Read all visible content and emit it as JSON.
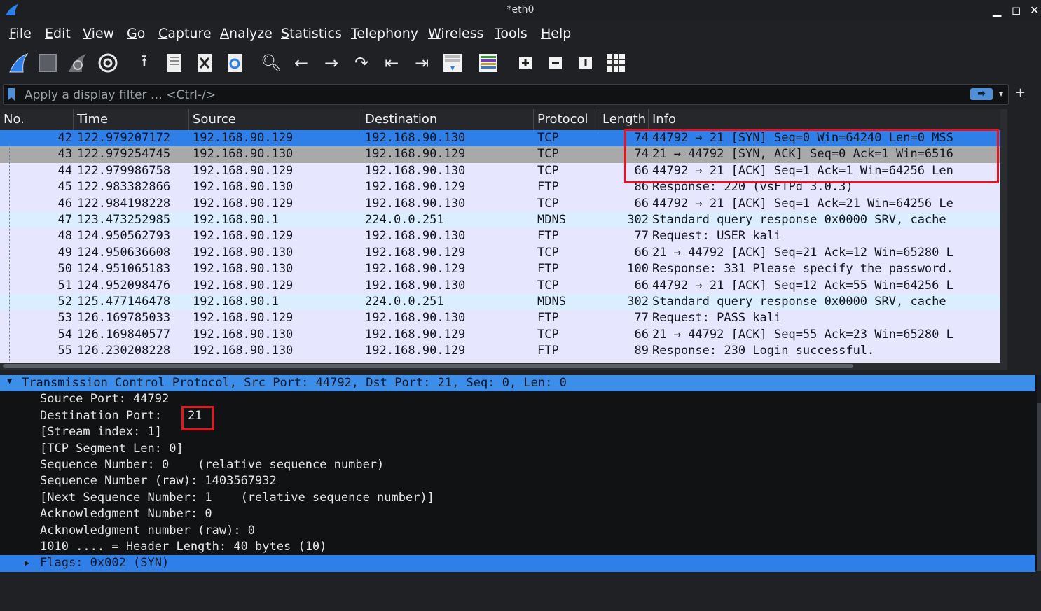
{
  "window": {
    "title": "*eth0"
  },
  "menu": [
    "File",
    "Edit",
    "View",
    "Go",
    "Capture",
    "Analyze",
    "Statistics",
    "Telephony",
    "Wireless",
    "Tools",
    "Help"
  ],
  "toolbar_icons": [
    "shark-fin-start-icon",
    "stop-square-icon",
    "restart-fin-icon",
    "capture-options-gear-icon",
    "open-file-upload-icon",
    "save-file-icon",
    "close-file-icon",
    "reload-file-icon",
    "search-icon",
    "back-arrow-icon",
    "forward-arrow-icon",
    "go-to-packet-icon",
    "first-packet-icon",
    "last-packet-icon",
    "autoscroll-icon",
    "colorize-icon",
    "zoom-in-icon",
    "zoom-out-icon",
    "normal-size-icon",
    "resize-columns-icon"
  ],
  "filter": {
    "placeholder": "Apply a display filter … <Ctrl-/>"
  },
  "packet_list": {
    "columns": [
      "No.",
      "Time",
      "Source",
      "Destination",
      "Protocol",
      "Length",
      "Info"
    ],
    "rows": [
      {
        "no": "42",
        "time": "122.979207172",
        "src": "192.168.90.129",
        "dst": "192.168.90.130",
        "proto": "TCP",
        "len": "74",
        "info": "44792 → 21 [SYN] Seq=0 Win=64240 Len=0 MSS",
        "state": "selected"
      },
      {
        "no": "43",
        "time": "122.979254745",
        "src": "192.168.90.130",
        "dst": "192.168.90.129",
        "proto": "TCP",
        "len": "74",
        "info": "21 → 44792 [SYN, ACK] Seq=0 Ack=1 Win=6516",
        "state": "related"
      },
      {
        "no": "44",
        "time": "122.979986758",
        "src": "192.168.90.129",
        "dst": "192.168.90.130",
        "proto": "TCP",
        "len": "66",
        "info": "44792 → 21 [ACK] Seq=1 Ack=1 Win=64256 Len",
        "state": "tcp"
      },
      {
        "no": "45",
        "time": "122.983382866",
        "src": "192.168.90.130",
        "dst": "192.168.90.129",
        "proto": "FTP",
        "len": "86",
        "info": "Response: 220 (vsFTPd 3.0.3)",
        "state": "tcp"
      },
      {
        "no": "46",
        "time": "122.984198228",
        "src": "192.168.90.129",
        "dst": "192.168.90.130",
        "proto": "TCP",
        "len": "66",
        "info": "44792 → 21 [ACK] Seq=1 Ack=21 Win=64256 Le",
        "state": "tcp"
      },
      {
        "no": "47",
        "time": "123.473252985",
        "src": "192.168.90.1",
        "dst": "224.0.0.251",
        "proto": "MDNS",
        "len": "302",
        "info": "Standard query response 0x0000 SRV, cache",
        "state": "udp"
      },
      {
        "no": "48",
        "time": "124.950562793",
        "src": "192.168.90.129",
        "dst": "192.168.90.130",
        "proto": "FTP",
        "len": "77",
        "info": "Request: USER kali",
        "state": "tcp"
      },
      {
        "no": "49",
        "time": "124.950636608",
        "src": "192.168.90.130",
        "dst": "192.168.90.129",
        "proto": "TCP",
        "len": "66",
        "info": "21 → 44792 [ACK] Seq=21 Ack=12 Win=65280 L",
        "state": "tcp"
      },
      {
        "no": "50",
        "time": "124.951065183",
        "src": "192.168.90.130",
        "dst": "192.168.90.129",
        "proto": "FTP",
        "len": "100",
        "info": "Response: 331 Please specify the password.",
        "state": "tcp"
      },
      {
        "no": "51",
        "time": "124.952098476",
        "src": "192.168.90.129",
        "dst": "192.168.90.130",
        "proto": "TCP",
        "len": "66",
        "info": "44792 → 21 [ACK] Seq=12 Ack=55 Win=64256 L",
        "state": "tcp"
      },
      {
        "no": "52",
        "time": "125.477146478",
        "src": "192.168.90.1",
        "dst": "224.0.0.251",
        "proto": "MDNS",
        "len": "302",
        "info": "Standard query response 0x0000 SRV, cache",
        "state": "udp"
      },
      {
        "no": "53",
        "time": "126.169785033",
        "src": "192.168.90.129",
        "dst": "192.168.90.130",
        "proto": "FTP",
        "len": "77",
        "info": "Request: PASS kali",
        "state": "tcp"
      },
      {
        "no": "54",
        "time": "126.169840577",
        "src": "192.168.90.130",
        "dst": "192.168.90.129",
        "proto": "TCP",
        "len": "66",
        "info": "21 → 44792 [ACK] Seq=55 Ack=23 Win=65280 L",
        "state": "tcp"
      },
      {
        "no": "55",
        "time": "126.230208228",
        "src": "192.168.90.130",
        "dst": "192.168.90.129",
        "proto": "FTP",
        "len": "89",
        "info": "Response: 230 Login successful.",
        "state": "tcp"
      }
    ]
  },
  "details": {
    "header": "Transmission Control Protocol, Src Port: 44792, Dst Port: 21, Seq: 0, Len: 0",
    "dest_port_label": "Destination Port: ",
    "dest_port_value": "21",
    "lines": [
      "Source Port: 44792",
      "",
      "[Stream index: 1]",
      "[TCP Segment Len: 0]",
      "Sequence Number: 0    (relative sequence number)",
      "Sequence Number (raw): 1403567932",
      "[Next Sequence Number: 1    (relative sequence number)]",
      "Acknowledgment Number: 0",
      "Acknowledgment number (raw): 0",
      "1010 .... = Header Length: 40 bytes (10)"
    ],
    "flags": "Flags: 0x002 (SYN)"
  },
  "colors": {
    "selected": "#2f7fe8",
    "related": "#a9a9a9",
    "tcp": "#e7e6ff",
    "udp": "#daeeff",
    "highlight_box": "#e3151f"
  }
}
